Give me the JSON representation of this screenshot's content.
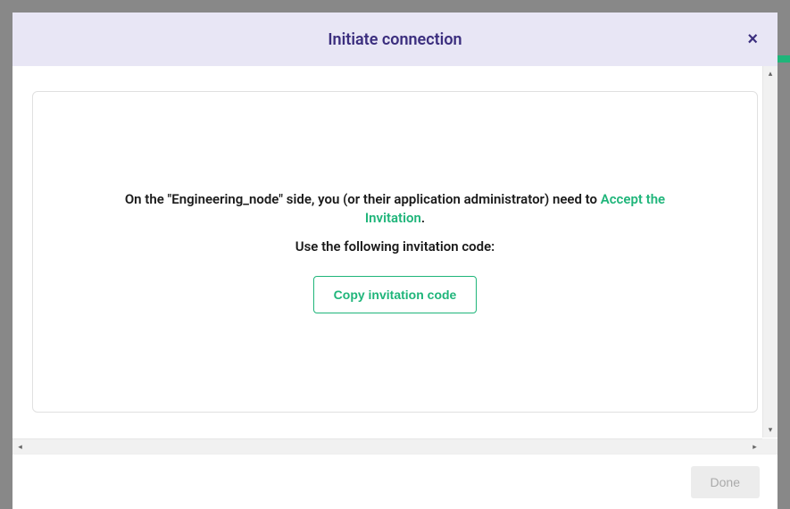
{
  "modal": {
    "title": "Initiate connection",
    "close_glyph": "×"
  },
  "card": {
    "instruction_prefix": "On the \"",
    "node_name": "Engineering_node",
    "instruction_middle": "\" side, you (or their application administrator) need to ",
    "link_text": "Accept the Invitation",
    "instruction_suffix": ".",
    "sub_instruction": "Use the following invitation code:",
    "copy_button": "Copy invitation code"
  },
  "footer": {
    "done_button": "Done"
  },
  "scroll": {
    "up": "▴",
    "down": "▾",
    "left": "◂",
    "right": "▸"
  }
}
